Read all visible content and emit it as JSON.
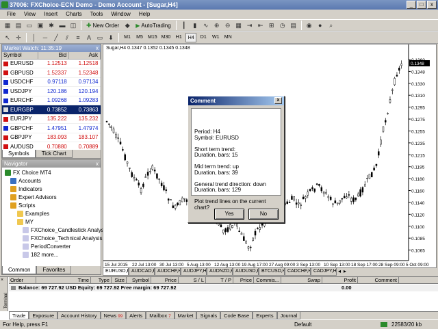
{
  "window": {
    "title": "37006: FXChoice-ECN Demo - Demo Account - [Sugar,H4]",
    "min": "_",
    "max": "□",
    "close": "x"
  },
  "menu": [
    "File",
    "View",
    "Insert",
    "Charts",
    "Tools",
    "Window",
    "Help"
  ],
  "toolbar": {
    "new_order": "New Order",
    "autotrading": "AutoTrading"
  },
  "timeframes": [
    "M1",
    "M5",
    "M15",
    "M30",
    "H1",
    "H4",
    "D1",
    "W1",
    "MN"
  ],
  "market_watch": {
    "title": "Market Watch: 11:35:19",
    "close": "x",
    "headers": {
      "symbol": "Symbol",
      "bid": "Bid",
      "ask": "Ask"
    },
    "rows": [
      {
        "symbol": "EURUSD",
        "bid": "1.12513",
        "ask": "1.12518",
        "dir": "dn"
      },
      {
        "symbol": "GBPUSD",
        "bid": "1.52337",
        "ask": "1.52348",
        "dir": "dn"
      },
      {
        "symbol": "USDCHF",
        "bid": "0.97118",
        "ask": "0.97134",
        "dir": "up"
      },
      {
        "symbol": "USDJPY",
        "bid": "120.186",
        "ask": "120.194",
        "dir": "up"
      },
      {
        "symbol": "EURCHF",
        "bid": "1.09268",
        "ask": "1.09283",
        "dir": "up"
      },
      {
        "symbol": "EURGBP",
        "bid": "0.73852",
        "ask": "0.73863",
        "dir": "sel"
      },
      {
        "symbol": "EURJPY",
        "bid": "135.222",
        "ask": "135.232",
        "dir": "dn"
      },
      {
        "symbol": "GBPCHF",
        "bid": "1.47951",
        "ask": "1.47974",
        "dir": "up"
      },
      {
        "symbol": "GBPJPY",
        "bid": "183.093",
        "ask": "183.107",
        "dir": "dn"
      },
      {
        "symbol": "AUDUSD",
        "bid": "0.70880",
        "ask": "0.70889",
        "dir": "dn"
      }
    ],
    "tabs": [
      "Symbols",
      "Tick Chart"
    ]
  },
  "navigator": {
    "title": "Navigator",
    "close": "x",
    "items": [
      "FX Choice MT4",
      "Accounts",
      "Indicators",
      "Expert Advisors",
      "Scripts",
      "Examples",
      "MY",
      "FXChoice_Candlestick Analysis",
      "FXChoice_Technical Analysis",
      "PeriodConverter",
      "182 more..."
    ],
    "tabs": [
      "Common",
      "Favorites"
    ]
  },
  "chart": {
    "header": "Sugar,H4  0.1347 0.1352 0.1345 0.1348",
    "price_labels": [
      "0.1360",
      "0.1348",
      "0.1330",
      "0.1310",
      "0.1295",
      "0.1275",
      "0.1255",
      "0.1235",
      "0.1215",
      "0.1195",
      "0.1180",
      "0.1160",
      "0.1140",
      "0.1120",
      "0.1100",
      "0.1085",
      "0.1065"
    ],
    "time_labels": [
      "15 Jul 2015",
      "22 Jul 13:00",
      "30 Jul 13:00",
      "5 Aug 13:00",
      "12 Aug 13:00",
      "19 Aug 17:00",
      "27 Aug 09:00",
      "3 Sep 13:00",
      "10 Sep 13:00",
      "18 Sep 17:00",
      "28 Sep 09:00",
      "5 Oct 09:00"
    ],
    "tabs": [
      "EURUSD,H4",
      "AUDCAD,H4",
      "AUDCHF,H4",
      "AUDJPY,H4",
      "AUDNZD,H4",
      "AUDUSD,H4",
      "BTCUSD,H4",
      "CADCHF,H4",
      "CADJPY,H4"
    ],
    "current_price": "0.1348"
  },
  "dialog": {
    "title": "Comment",
    "close": "x",
    "lines": [
      "Period: H4",
      "Symbol: EURUSD",
      "",
      "Short term trend:",
      "Duration, bars: 15",
      "",
      "Mid term trend: up",
      "Duration, bars: 39",
      "",
      "General trend direction: down",
      "Duration, bars: 129",
      "",
      "Plot trend lines on the current chart?"
    ],
    "yes": "Yes",
    "no": "No"
  },
  "terminal": {
    "headers": [
      "Order",
      "Time",
      "Type",
      "Size",
      "Symbol",
      "Price",
      "S / L",
      "T / P",
      "Price",
      "Commis...",
      "Swap",
      "Profit",
      "Comment"
    ],
    "balance_line": "Balance: 69 727.92 USD  Equity: 69 727.92  Free margin: 69 727.92",
    "profit": "0.00",
    "side_label": "Terminal",
    "tabs": [
      "Trade",
      "Exposure",
      "Account History",
      "News",
      "Alerts",
      "Mailbox",
      "Market",
      "Signals",
      "Code Base",
      "Experts",
      "Journal"
    ],
    "news_badge": "99",
    "mailbox_badge": "7"
  },
  "status": {
    "help": "For Help, press F1",
    "profile": "Default",
    "traffic": "22583/20 kb"
  }
}
